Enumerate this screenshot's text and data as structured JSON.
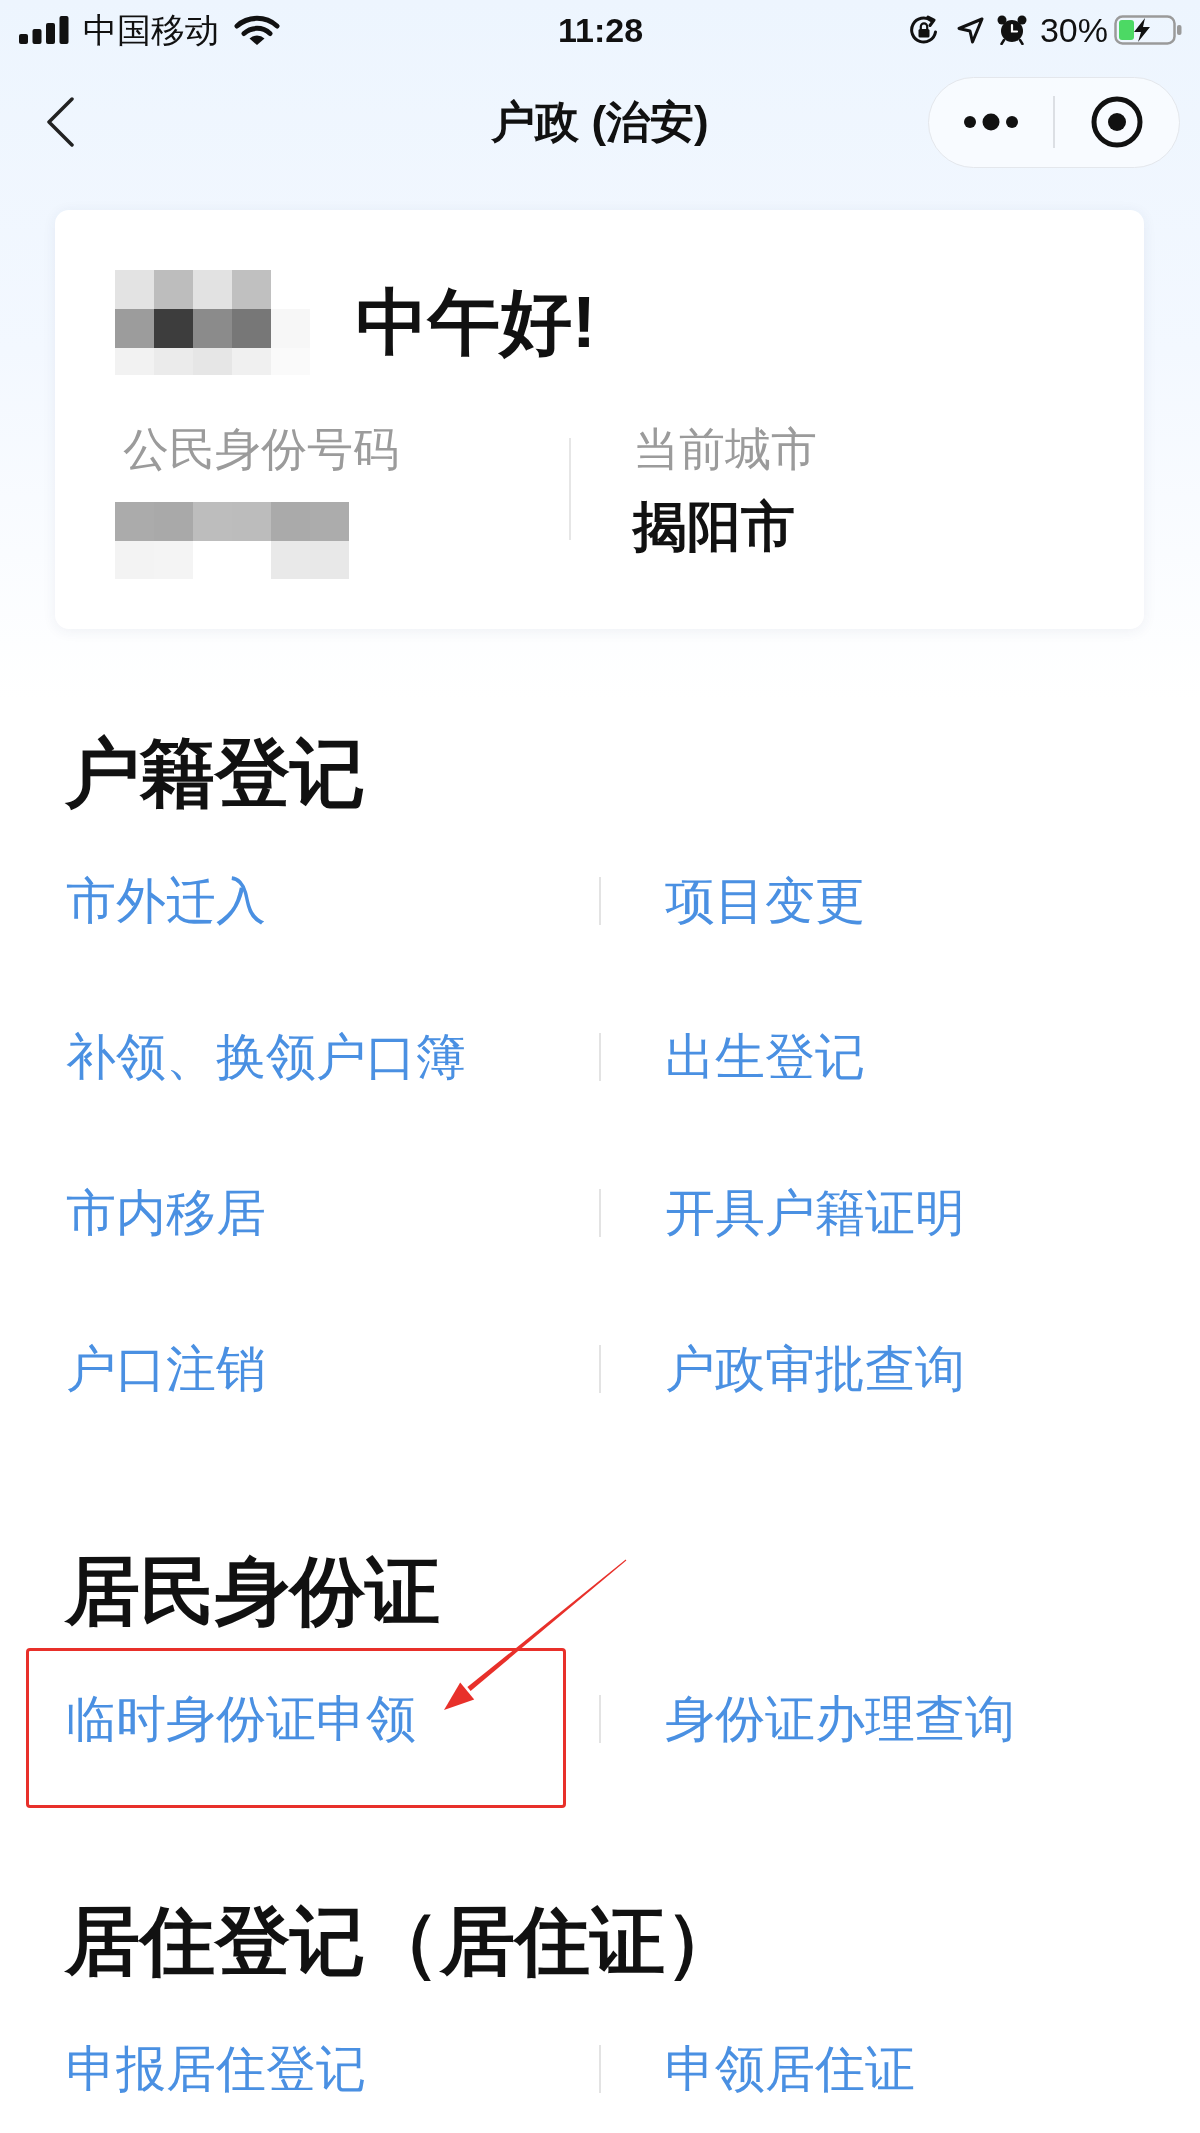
{
  "status_bar": {
    "carrier": "中国移动",
    "time": "11:28",
    "battery": "30%"
  },
  "nav_bar": {
    "title": "户政 (治安)"
  },
  "profile_card": {
    "greeting": "中午好!",
    "id_label": "公民身份号码",
    "city_label": "当前城市",
    "city": "揭阳市"
  },
  "sections": [
    {
      "title": "户籍登记",
      "links": [
        {
          "label": "市外迁入",
          "highlighted": false
        },
        {
          "label": "项目变更",
          "highlighted": false
        },
        {
          "label": "补领、换领户口簿",
          "highlighted": false
        },
        {
          "label": "出生登记",
          "highlighted": false
        },
        {
          "label": "市内移居",
          "highlighted": false
        },
        {
          "label": "开具户籍证明",
          "highlighted": false
        },
        {
          "label": "户口注销",
          "highlighted": false
        },
        {
          "label": "户政审批查询",
          "highlighted": false
        }
      ]
    },
    {
      "title": "居民身份证",
      "links": [
        {
          "label": "临时身份证申领",
          "highlighted": true
        },
        {
          "label": "身份证办理查询",
          "highlighted": false
        }
      ]
    },
    {
      "title": "居住登记（居住证）",
      "links": [
        {
          "label": "申报居住登记",
          "highlighted": false
        },
        {
          "label": "申领居住证",
          "highlighted": false
        }
      ]
    }
  ]
}
